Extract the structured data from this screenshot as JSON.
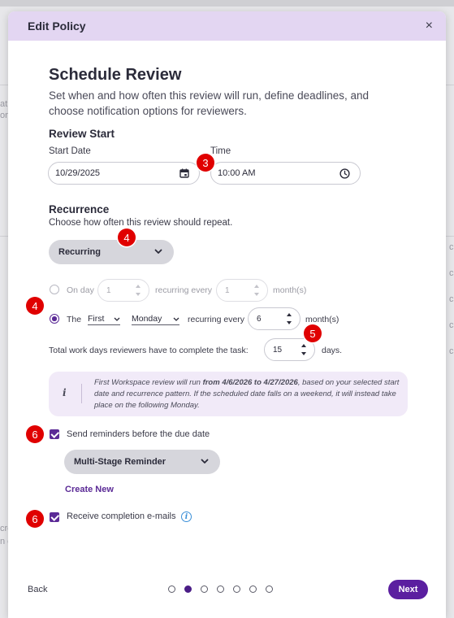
{
  "background": {
    "fragments_left": [
      "at",
      "on",
      "cre",
      "n c"
    ],
    "fragments_right": [
      "c",
      "c",
      "c",
      "c",
      "c"
    ]
  },
  "modal": {
    "title": "Edit Policy",
    "close_glyph": "×"
  },
  "page": {
    "heading": "Schedule Review",
    "description": "Set when and how often this review will run, define deadlines, and choose notification options for reviewers."
  },
  "review_start": {
    "heading": "Review Start",
    "start_date_label": "Start Date",
    "start_date_value": "10/29/2025",
    "time_label": "Time",
    "time_value": "10:00 AM"
  },
  "recurrence": {
    "heading": "Recurrence",
    "subtext": "Choose how often this review should repeat.",
    "mode_selected": "Recurring",
    "option_on_day": {
      "label": "On day",
      "day_value": "1",
      "recurring_every_label": "recurring every",
      "every_value": "1",
      "unit": "month(s)",
      "selected": false
    },
    "option_the": {
      "label": "The",
      "ordinal_selected": "First",
      "weekday_selected": "Monday",
      "recurring_every_label": "recurring every",
      "every_value": "6",
      "unit": "month(s)",
      "selected": true
    },
    "workdays_label": "Total work days reviewers have to complete the task:",
    "workdays_value": "15",
    "workdays_unit": "days."
  },
  "info": {
    "icon": "i",
    "text_before": "First Workspace review will run ",
    "text_bold": "from 4/6/2026 to 4/27/2026",
    "text_after": ", based on your selected start date and recurrence pattern. If the scheduled date falls on a weekend, it will instead take place on the following Monday."
  },
  "reminders": {
    "checkbox_label": "Send reminders before the due date",
    "checked": true,
    "reminder_selected": "Multi-Stage Reminder",
    "create_new_label": "Create New"
  },
  "completion": {
    "checkbox_label": "Receive completion e-mails",
    "checked": true,
    "help_glyph": "i"
  },
  "annotations": {
    "badge_time": "3",
    "badge_recurrence": "4",
    "badge_the_option": "4",
    "badge_workdays": "5",
    "badge_reminders": "6",
    "badge_completion": "6"
  },
  "footer": {
    "back_label": "Back",
    "next_label": "Next",
    "steps_total": 7,
    "current_step": 2
  },
  "colors": {
    "header_bg": "#e3d6f2",
    "accent": "#5b2a96",
    "info_bg": "#f1eaf8",
    "badge": "#e00000"
  }
}
